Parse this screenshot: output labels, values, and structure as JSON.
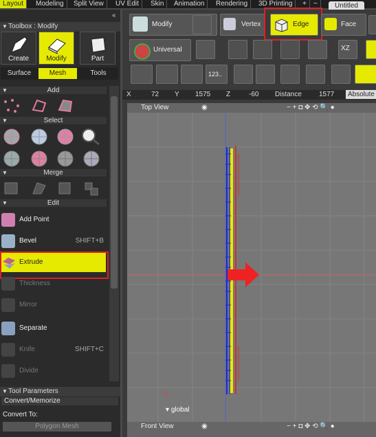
{
  "menu_tabs": [
    "Layout",
    "Modeling",
    "Split View",
    "UV Edit",
    "Skin",
    "Animation",
    "Rendering",
    "3D Printing",
    "+",
    "−"
  ],
  "document_tab": "Untitled",
  "toolbox": {
    "title": "Toolbox : Modify",
    "modes": [
      "Create",
      "Modify",
      "Part"
    ],
    "subtabs": [
      "Surface",
      "Mesh",
      "Tools"
    ],
    "sections": {
      "add": "Add",
      "select": "Select",
      "merge": "Merge",
      "edit": "Edit"
    },
    "edit_items": [
      {
        "label": "Add Point",
        "shortcut": ""
      },
      {
        "label": "Bevel",
        "shortcut": "SHIFT+B"
      },
      {
        "label": "Extrude",
        "shortcut": ""
      },
      {
        "label": "Thickness",
        "shortcut": ""
      },
      {
        "label": "Mirror",
        "shortcut": ""
      },
      {
        "label": "Separate",
        "shortcut": ""
      },
      {
        "label": "Knife",
        "shortcut": "SHIFT+C"
      },
      {
        "label": "Divide",
        "shortcut": ""
      }
    ],
    "tool_params_title": "Tool Parameters",
    "convert_section": "Convert/Memorize",
    "convert_to_label": "Convert To:",
    "convert_to_value": "Polygon Mesh"
  },
  "toolbar": {
    "modify": "Modify",
    "vertex": "Vertex",
    "edge": "Edge",
    "face": "Face",
    "universal": "Universal"
  },
  "coords": {
    "x_label": "X",
    "x": "72",
    "y_label": "Y",
    "y": "1575",
    "z_label": "Z",
    "z": "-60",
    "distance_label": "Distance",
    "distance": "1577",
    "mode": "Absolute"
  },
  "viewport": {
    "top_title": "Top View",
    "bottom_title": "Front View",
    "global_label": "global",
    "view_controls": "− + ◘ ✥ ⟲ 🔍 ●"
  },
  "colors": {
    "accent": "#e6ea00",
    "highlight": "#e02020",
    "mesh_edge": "#1a2acc"
  }
}
